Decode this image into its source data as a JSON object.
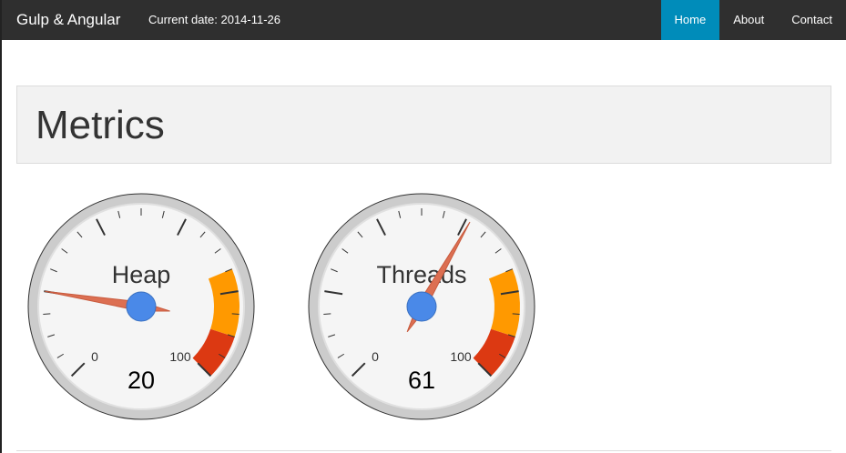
{
  "navbar": {
    "brand": "Gulp & Angular",
    "current_date": "Current date: 2014-11-26",
    "links": [
      {
        "label": "Home",
        "active": true
      },
      {
        "label": "About",
        "active": false
      },
      {
        "label": "Contact",
        "active": false
      }
    ],
    "active_color": "#008cba"
  },
  "page": {
    "title": "Metrics"
  },
  "gauges": [
    {
      "label": "Heap",
      "value": 20,
      "min": "0",
      "max": "100",
      "min_value": 0,
      "max_value": 100
    },
    {
      "label": "Threads",
      "value": 61,
      "min": "0",
      "max": "100",
      "min_value": 0,
      "max_value": 100
    }
  ],
  "gauge_style": {
    "warning_color": "#ff9900",
    "danger_color": "#dc3912",
    "needle_color": "#dc6f52",
    "hub_color": "#4a89e8"
  }
}
